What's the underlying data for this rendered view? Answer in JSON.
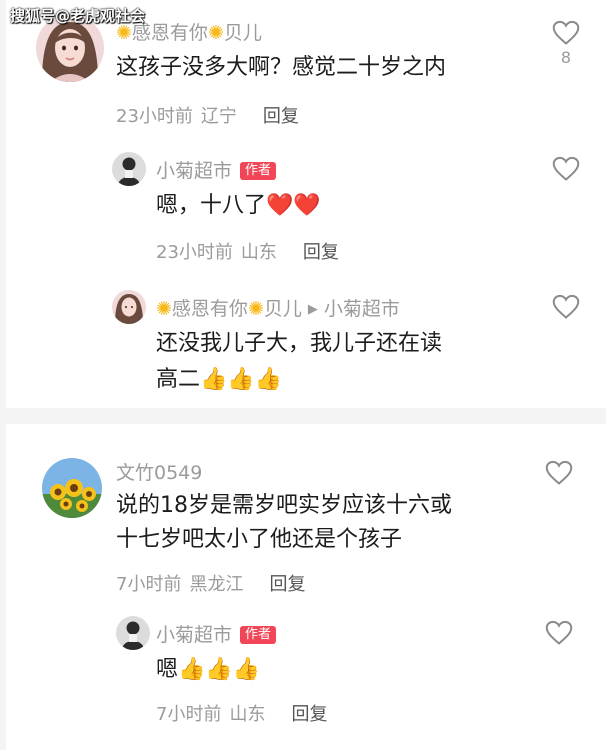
{
  "watermark": "搜狐号@老虎观社会",
  "thread1": {
    "comment": {
      "user": "感恩有你",
      "user2": "贝儿",
      "text": "这孩子没多大啊？感觉二十岁之内",
      "time": "23小时前",
      "location": "辽宁",
      "reply": "回复",
      "likes": "8"
    },
    "reply1": {
      "user": "小菊超市",
      "badge": "作者",
      "text": "嗯，十八了❤️❤️",
      "time": "23小时前",
      "location": "山东",
      "reply": "回复"
    },
    "reply2": {
      "user": "感恩有你",
      "user2": "贝儿",
      "reply_to": "小菊超市",
      "text_line1": "还没我儿子大，我儿子还在读",
      "text_line2": "高二👍👍👍"
    }
  },
  "thread2": {
    "comment": {
      "user": "文竹0549",
      "text_line1": "说的18岁是需岁吧实岁应该十六或",
      "text_line2": "十七岁吧太小了他还是个孩子",
      "time": "7小时前",
      "location": "黑龙江",
      "reply": "回复"
    },
    "reply1": {
      "user": "小菊超市",
      "badge": "作者",
      "text": "嗯👍👍👍",
      "time": "7小时前",
      "location": "山东",
      "reply": "回复"
    }
  },
  "icons": {
    "like": "heart-outline-icon",
    "sun": "sun-emoji-icon",
    "arrow": "triangle-right-icon"
  },
  "colors": {
    "badge": "#f24558",
    "meta": "#9b9b9b",
    "text": "#1c1c1c"
  }
}
